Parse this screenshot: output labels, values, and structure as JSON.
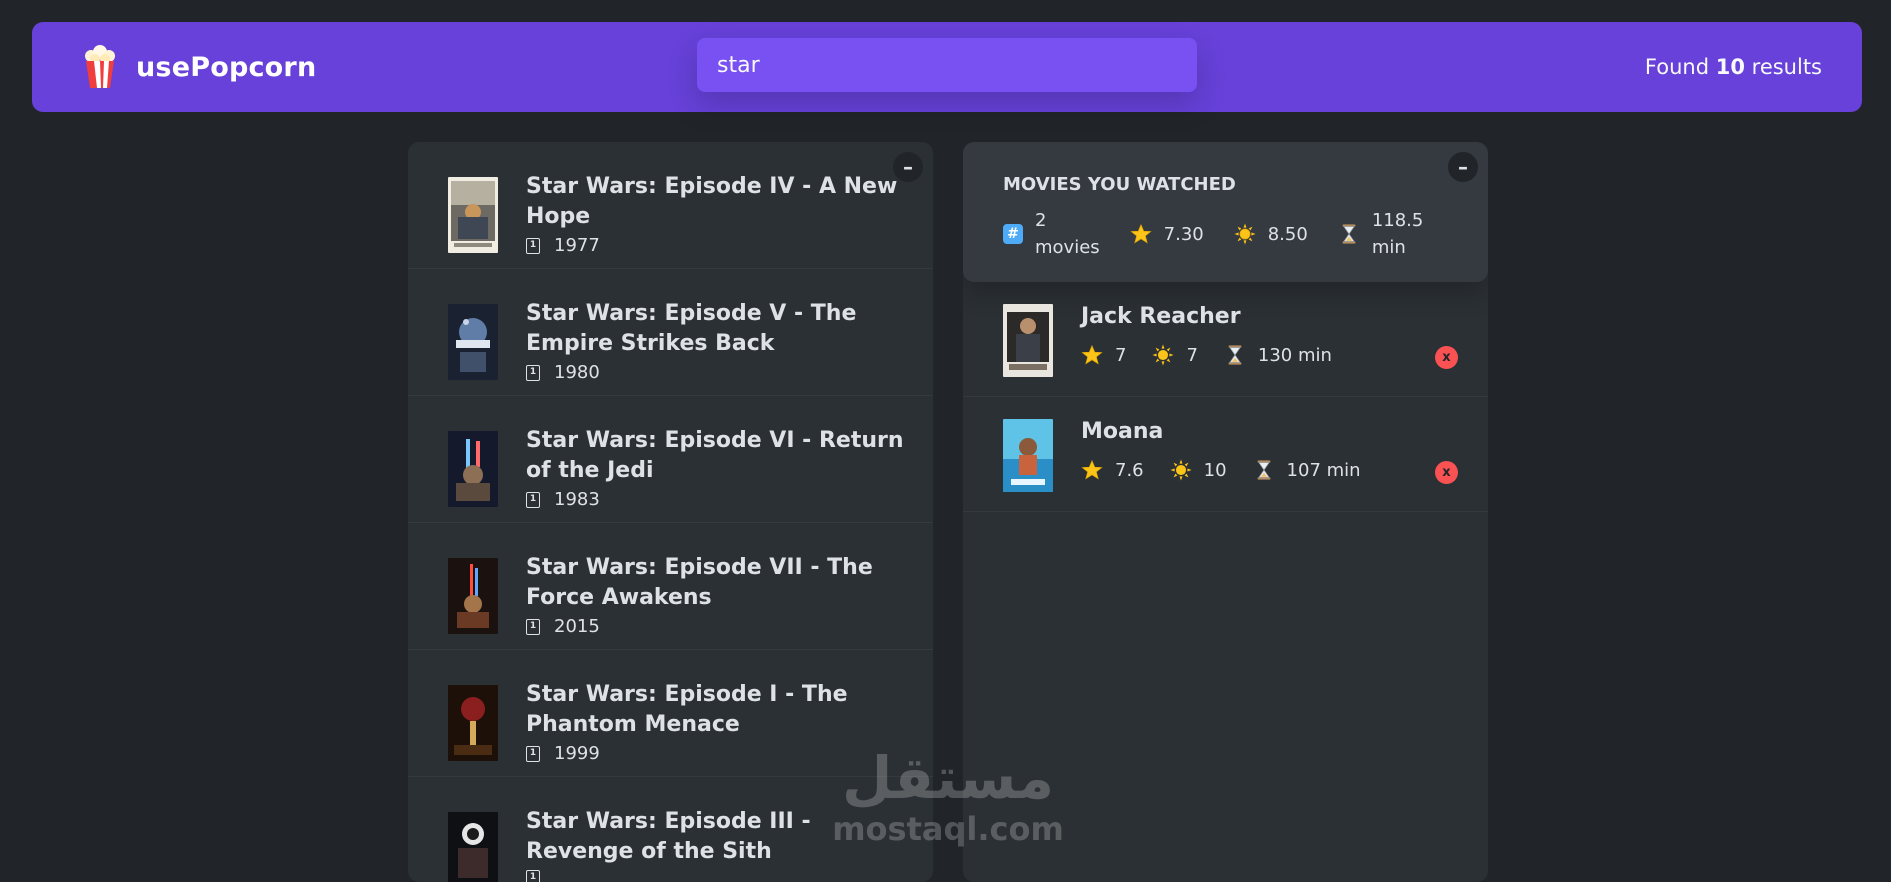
{
  "app": {
    "name": "usePopcorn"
  },
  "search": {
    "value": "star"
  },
  "results": {
    "prefix": "Found",
    "count": "10",
    "suffix": "results"
  },
  "movies": [
    {
      "title": "Star Wars: Episode IV - A New Hope",
      "year": "1977"
    },
    {
      "title": "Star Wars: Episode V - The Empire Strikes Back",
      "year": "1980"
    },
    {
      "title": "Star Wars: Episode VI - Return of the Jedi",
      "year": "1983"
    },
    {
      "title": "Star Wars: Episode VII - The Force Awakens",
      "year": "2015"
    },
    {
      "title": "Star Wars: Episode I - The Phantom Menace",
      "year": "1999"
    },
    {
      "title": "Star Wars: Episode III - Revenge of the Sith",
      "year": ""
    }
  ],
  "toggle_label": "–",
  "summary": {
    "title": "MOVIES YOU WATCHED",
    "movies_count": "2",
    "movies_label": "movies",
    "avg_imdb": "7.30",
    "avg_user": "8.50",
    "avg_runtime": "118.5",
    "runtime_unit": "min"
  },
  "watched": [
    {
      "title": "Jack Reacher",
      "imdb": "7",
      "user": "7",
      "runtime": "130 min"
    },
    {
      "title": "Moana",
      "imdb": "7.6",
      "user": "10",
      "runtime": "107 min"
    }
  ],
  "delete_label": "x",
  "watermark": {
    "arabic": "مستقل",
    "latin": "mostaql.com"
  },
  "colors": {
    "background": "#212529",
    "nav": "#6741d9",
    "search": "#7950f2",
    "box": "#2b3035",
    "summary": "#343a40",
    "delete": "#fa5252",
    "star": "#fcc419"
  }
}
